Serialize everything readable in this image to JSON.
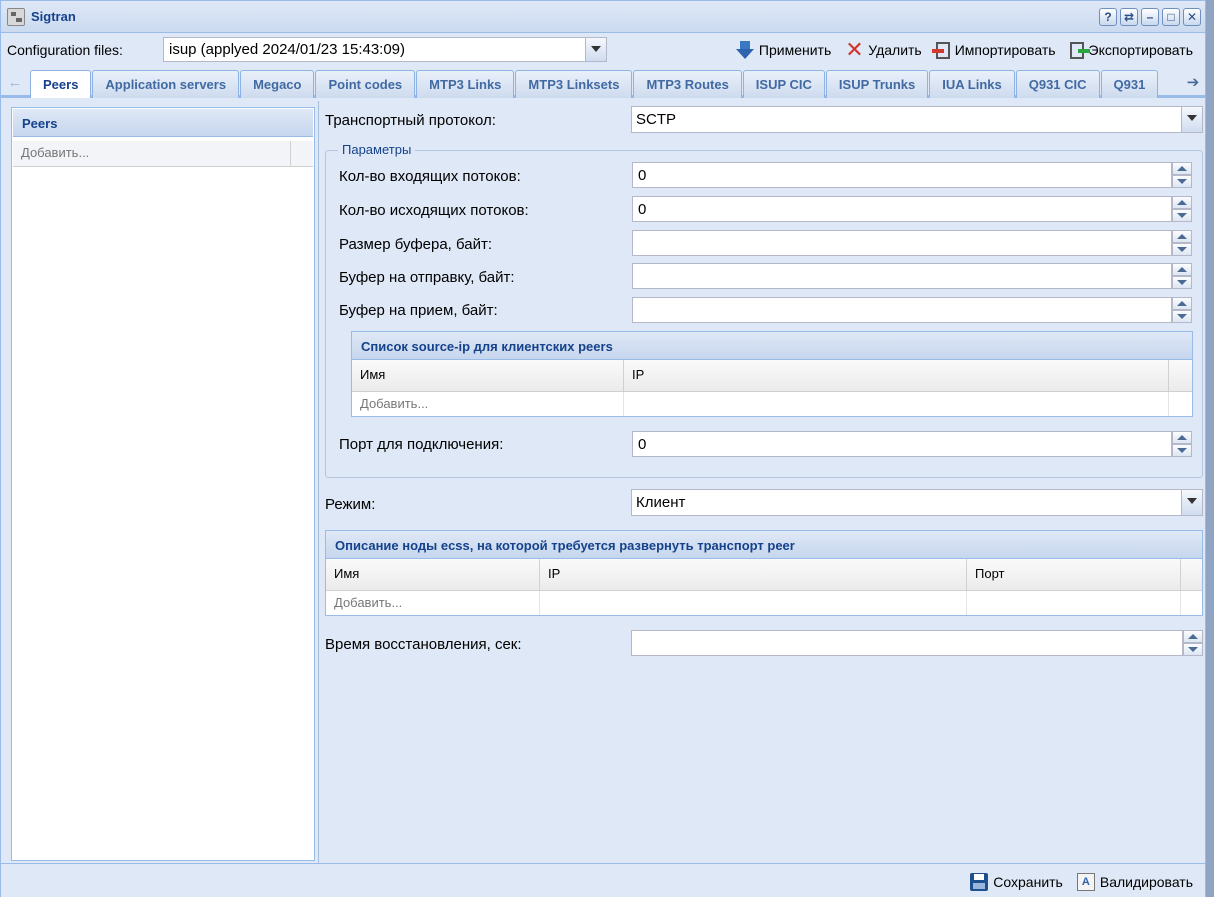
{
  "window": {
    "title": "Sigtran",
    "controls": [
      "?",
      "⇄",
      "–",
      "□",
      "✕"
    ]
  },
  "config": {
    "label": "Configuration files:",
    "selected": "isup (applyed 2024/01/23 15:43:09)"
  },
  "actions": {
    "apply": "Применить",
    "delete": "Удалить",
    "import": "Импортировать",
    "export": "Экспортировать"
  },
  "tabs": [
    "Peers",
    "Application servers",
    "Megaco",
    "Point codes",
    "MTP3 Links",
    "MTP3 Linksets",
    "MTP3 Routes",
    "ISUP CIC",
    "ISUP Trunks",
    "IUA Links",
    "Q931 CIC",
    "Q931"
  ],
  "left_panel": {
    "title": "Peers",
    "add": "Добавить..."
  },
  "form": {
    "transport_label": "Транспортный протокол:",
    "transport_value": "SCTP",
    "params_legend": "Параметры",
    "in_streams_label": "Кол-во входящих потоков:",
    "in_streams_value": "0",
    "out_streams_label": "Кол-во исходящих потоков:",
    "out_streams_value": "0",
    "buffer_label": "Размер буфера, байт:",
    "buffer_value": "",
    "send_buffer_label": "Буфер на отправку, байт:",
    "send_buffer_value": "",
    "recv_buffer_label": "Буфер на прием, байт:",
    "recv_buffer_value": "",
    "source_ip_grid": {
      "title": "Список source-ip для клиентских peers",
      "col_name": "Имя",
      "col_ip": "IP",
      "add": "Добавить..."
    },
    "port_label": "Порт для подключения:",
    "port_value": "0",
    "mode_label": "Режим:",
    "mode_value": "Клиент",
    "node_grid": {
      "title": "Описание ноды ecss, на которой требуется развернуть транспорт peer",
      "col_name": "Имя",
      "col_ip": "IP",
      "col_port": "Порт",
      "add": "Добавить..."
    },
    "recovery_label": "Время восстановления, сек:",
    "recovery_value": ""
  },
  "bottom": {
    "save": "Сохранить",
    "validate": "Валидировать"
  }
}
